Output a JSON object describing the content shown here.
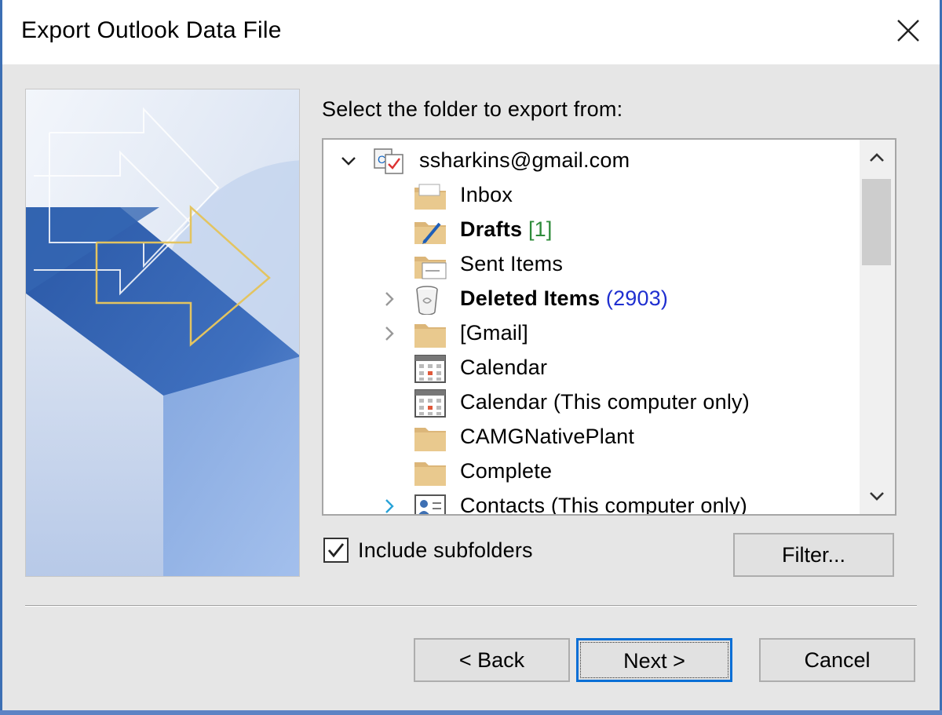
{
  "window": {
    "title": "Export Outlook Data File"
  },
  "instruction": "Select the folder to export from:",
  "tree": {
    "items": [
      {
        "label": "ssharkins@gmail.com",
        "icon": "account-icon",
        "expander": "expanded",
        "selected": true
      },
      {
        "label": "Inbox",
        "icon": "folder-mail-icon"
      },
      {
        "label": "Drafts",
        "count": "[1]",
        "bold": true,
        "icon": "drafts-icon"
      },
      {
        "label": "Sent Items",
        "icon": "sent-items-icon"
      },
      {
        "label": "Deleted Items",
        "count": "(2903)",
        "bold": true,
        "icon": "trash-icon",
        "expander": "collapsed"
      },
      {
        "label": "[Gmail]",
        "icon": "folder-icon",
        "expander": "collapsed"
      },
      {
        "label": "Calendar",
        "icon": "calendar-icon"
      },
      {
        "label": "Calendar (This computer only)",
        "icon": "calendar-icon"
      },
      {
        "label": "CAMGNativePlant",
        "icon": "folder-icon"
      },
      {
        "label": "Complete",
        "icon": "folder-icon"
      },
      {
        "label": "Contacts (This computer only)",
        "icon": "contacts-icon",
        "expander": "collapsed-hover"
      }
    ]
  },
  "options": {
    "include_subfolders_label": "Include subfolders",
    "include_subfolders_checked": true
  },
  "buttons": {
    "filter": "Filter...",
    "back": "< Back",
    "next": "Next >",
    "cancel": "Cancel"
  },
  "colors": {
    "accent": "#0a6fd6",
    "selection": "#d9ebf9",
    "count_green": "#2e8b3a",
    "count_blue": "#1f2fd0",
    "folder": "#dcb679"
  }
}
